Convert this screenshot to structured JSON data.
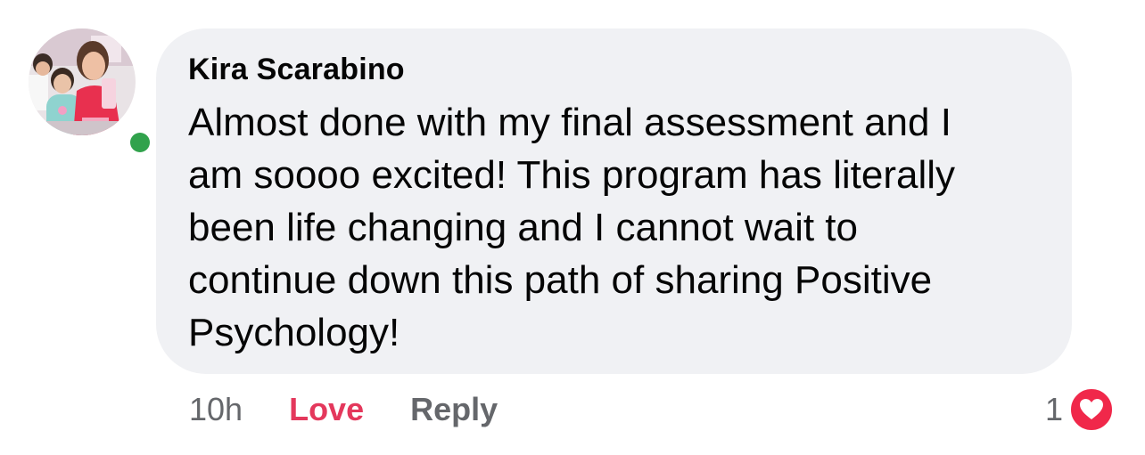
{
  "comment": {
    "author": "Kira Scarabino",
    "text": "Almost done with my final assessment and I\nam soooo excited! This program has literally\nbeen life changing and I cannot wait to\ncontinue down this path of sharing Positive\nPsychology!",
    "online": true
  },
  "actions": {
    "timestamp": "10h",
    "love_label": "Love",
    "reply_label": "Reply"
  },
  "reactions": {
    "count": "1",
    "icon": "heart-icon"
  },
  "colors": {
    "love": "#e4385c",
    "heart_badge": "#f0284a",
    "online": "#31a24c",
    "bubble": "#f0f1f4",
    "muted_text": "#65676b"
  }
}
